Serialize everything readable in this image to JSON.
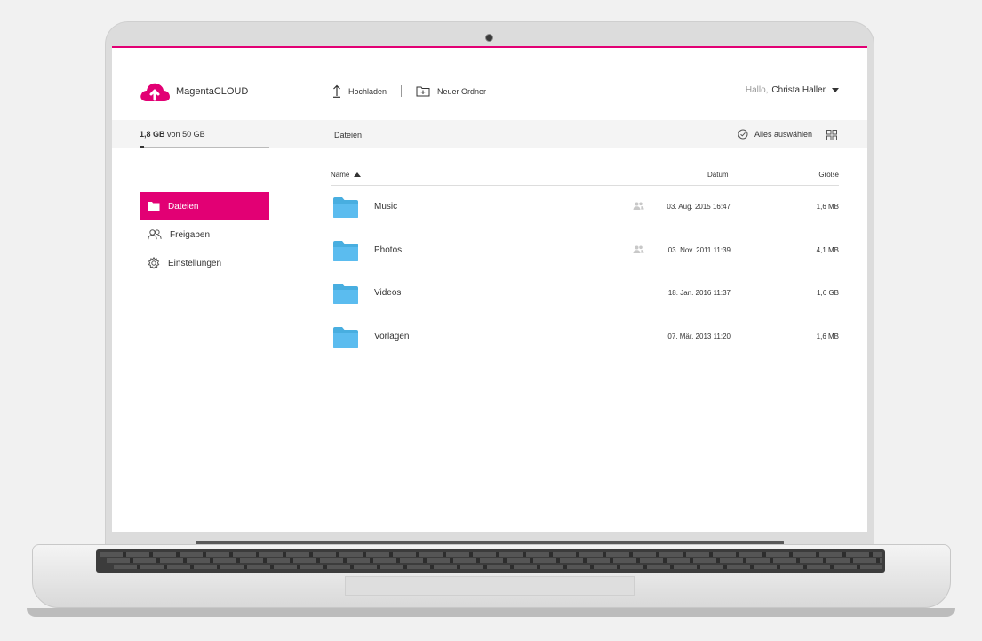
{
  "brand": {
    "name_part1": "Magenta",
    "name_part2": "CLOUD",
    "accent": "#e20074",
    "logo_icon": "cloud-upload-icon"
  },
  "toolbar": {
    "upload_label": "Hochladen",
    "new_folder_label": "Neuer Ordner"
  },
  "user": {
    "greeting": "Hallo,",
    "name": "Christa Haller"
  },
  "storage": {
    "used": "1,8 GB",
    "of_label": "von",
    "total": "50 GB",
    "used_fraction": 0.036
  },
  "breadcrumb": {
    "current": "Dateien"
  },
  "actions": {
    "select_all_label": "Alles auswählen",
    "view_toggle_icon": "grid-view-icon"
  },
  "sidebar": {
    "items": [
      {
        "label": "Dateien",
        "icon": "folder-icon",
        "active": true
      },
      {
        "label": "Freigaben",
        "icon": "people-icon",
        "active": false
      },
      {
        "label": "Einstellungen",
        "icon": "gear-icon",
        "active": false
      }
    ]
  },
  "table": {
    "columns": {
      "name": "Name",
      "date": "Datum",
      "size": "Größe"
    },
    "rows": [
      {
        "name": "Music",
        "shared": true,
        "date": "03. Aug. 2015 16:47",
        "size": "1,6 MB"
      },
      {
        "name": "Photos",
        "shared": true,
        "date": "03. Nov. 2011 11:39",
        "size": "4,1 MB"
      },
      {
        "name": "Videos",
        "shared": false,
        "date": "18. Jan. 2016 11:37",
        "size": "1,6 GB"
      },
      {
        "name": "Vorlagen",
        "shared": false,
        "date": "07. Mär. 2013 11:20",
        "size": "1,6 MB"
      }
    ]
  },
  "colors": {
    "folder": "#5bbcef",
    "active_nav": "#e20074"
  }
}
